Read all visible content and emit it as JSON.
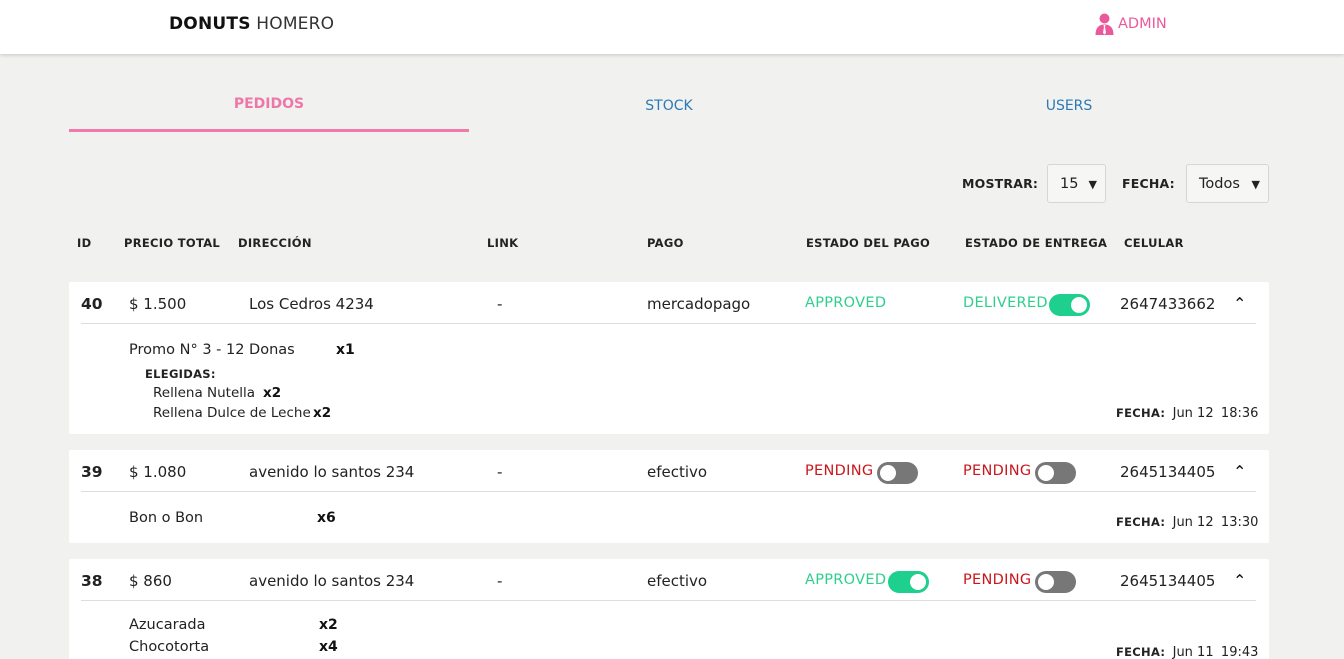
{
  "header": {
    "brand_bold": "DONUTS",
    "brand_light": "HOMERO",
    "admin_label": "ADMIN",
    "accent_color": "#ea5a9b"
  },
  "tabs": [
    {
      "label": "PEDIDOS",
      "active": true
    },
    {
      "label": "STOCK",
      "active": false
    },
    {
      "label": "USERS",
      "active": false
    }
  ],
  "filters": {
    "mostrar_label": "MOSTRAR:",
    "mostrar_value": "15",
    "fecha_label": "FECHA:",
    "fecha_value": "Todos"
  },
  "columns": [
    "ID",
    "PRECIO TOTAL",
    "DIRECCIÓN",
    "LINK",
    "PAGO",
    "ESTADO DEL PAGO",
    "ESTADO DE ENTREGA",
    "CELULAR"
  ],
  "orders": [
    {
      "id": "40",
      "precio": "$ 1.500",
      "direccion": "Los Cedros 4234",
      "link": "-",
      "pago": "mercadopago",
      "estado_pago": "APPROVED",
      "estado_pago_toggle": null,
      "estado_entrega": "DELIVERED",
      "estado_entrega_toggle": true,
      "celular": "2647433662",
      "items": [
        {
          "name": "Promo N° 3 - 12 Donas",
          "qty": "x1"
        }
      ],
      "elegidas_label": "ELEGIDAS:",
      "elegidas": [
        {
          "name": "Rellena Nutella",
          "qty": "x2"
        },
        {
          "name": "Rellena Dulce de Leche",
          "qty": "x2"
        }
      ],
      "fecha_label": "FECHA:",
      "fecha_day": "Jun 12",
      "fecha_time": "18:36"
    },
    {
      "id": "39",
      "precio": "$ 1.080",
      "direccion": "avenido lo santos 234",
      "link": "-",
      "pago": "efectivo",
      "estado_pago": "PENDING",
      "estado_pago_toggle": false,
      "estado_entrega": "PENDING",
      "estado_entrega_toggle": false,
      "celular": "2645134405",
      "items": [
        {
          "name": "Bon o Bon",
          "qty": "x6"
        }
      ],
      "fecha_label": "FECHA:",
      "fecha_day": "Jun 12",
      "fecha_time": "13:30"
    },
    {
      "id": "38",
      "precio": "$ 860",
      "direccion": "avenido lo santos 234",
      "link": "-",
      "pago": "efectivo",
      "estado_pago": "APPROVED",
      "estado_pago_toggle": true,
      "estado_entrega": "PENDING",
      "estado_entrega_toggle": false,
      "celular": "2645134405",
      "items": [
        {
          "name": "Azucarada",
          "qty": "x2"
        },
        {
          "name": "Chocotorta",
          "qty": "x4"
        }
      ],
      "fecha_label": "FECHA:",
      "fecha_day": "Jun 11",
      "fecha_time": "19:43"
    }
  ]
}
